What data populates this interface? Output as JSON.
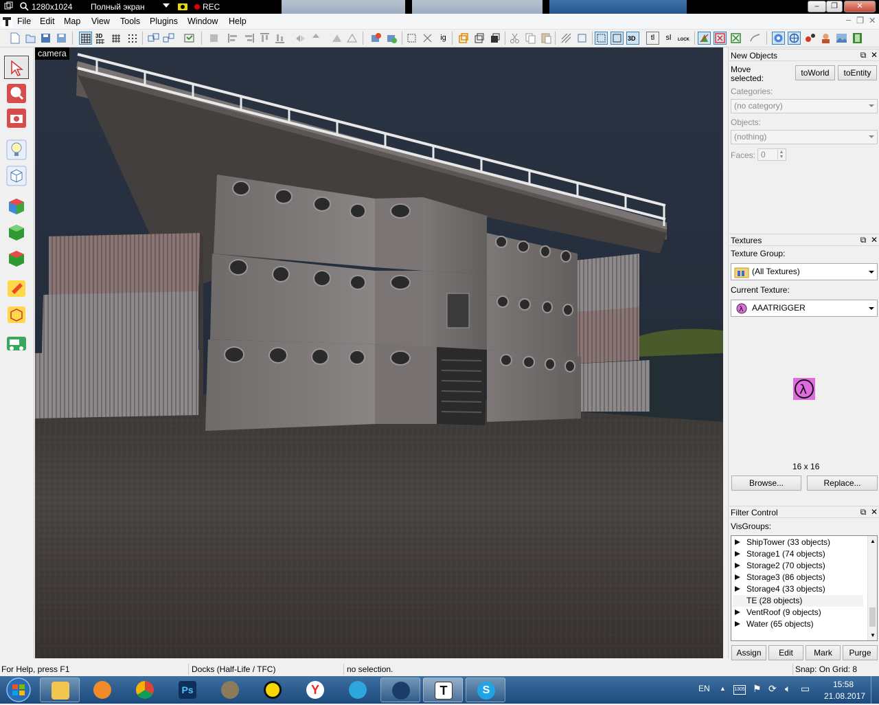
{
  "recorder": {
    "resolution": "1280x1024",
    "mode": "Полный экран",
    "rec_label": "REC"
  },
  "menu": [
    "File",
    "Edit",
    "Map",
    "View",
    "Tools",
    "Plugins",
    "Window",
    "Help"
  ],
  "toolbar": {
    "icons": [
      "new-file-icon",
      "open-file-icon",
      "save-icon",
      "save-as-icon",
      "grid-icon",
      "grid-3d-icon",
      "grid-small-icon",
      "grid-dots-icon",
      "group-icon",
      "ungroup-icon",
      "load-window-state-icon",
      "save-window-state-icon",
      "texture-lock-icon",
      "align-left-icon",
      "align-right-icon",
      "align-top-icon",
      "align-bottom-icon",
      "flip-horizontal-icon",
      "flip-vertical-icon",
      "carve-icon",
      "hollow-icon",
      "run-map-icon",
      "check-problems-icon",
      "transform-icon",
      "cut-icon",
      "copy-icon",
      "paste-icon",
      "toggle-texture-lock-icon",
      "ignore-groups-icon",
      "hide-selected-icon",
      "hide-unselected-icon",
      "show-all-icon",
      "tie-to-entity-icon",
      "move-to-world-icon",
      "lock-icon",
      "entity-report-icon",
      "select-brushes-icon",
      "select-entities-icon",
      "select-all-icon",
      "smoothing-groups-icon",
      "camera-view-icon",
      "camera-3d-icon",
      "color-icon",
      "user-icon",
      "render-view-icon",
      "film-icon"
    ],
    "text_buttons": [
      "ig",
      "tl",
      "sl"
    ]
  },
  "left_tools": [
    "selection-tool-icon",
    "magnify-tool-icon",
    "camera-tool-icon",
    "entity-tool-icon",
    "block-tool-icon",
    "texture-application-icon",
    "apply-current-texture-icon",
    "decal-tool-icon",
    "clipping-tool-icon",
    "vertex-manipulation-icon",
    "path-tool-icon"
  ],
  "viewport": {
    "label": "camera"
  },
  "new_objects": {
    "title": "New Objects",
    "move_selected_label_line1": "Move",
    "move_selected_label_line2": "selected:",
    "to_world": "toWorld",
    "to_entity": "toEntity",
    "categories_label": "Categories:",
    "categories_value": "(no category)",
    "objects_label": "Objects:",
    "objects_value": "(nothing)",
    "faces_label": "Faces:",
    "faces_value": "0"
  },
  "textures": {
    "title": "Textures",
    "group_label": "Texture Group:",
    "group_value": "(All Textures)",
    "current_label": "Current Texture:",
    "current_value": "AAATRIGGER",
    "size": "16 x 16",
    "browse": "Browse...",
    "replace": "Replace..."
  },
  "filter": {
    "title": "Filter Control",
    "visgroups_label": "VisGroups:",
    "visgroups": [
      {
        "name": "ShipTower (33 objects)",
        "selected": false
      },
      {
        "name": "Storage1 (74 objects)",
        "selected": false
      },
      {
        "name": "Storage2 (70 objects)",
        "selected": false
      },
      {
        "name": "Storage3 (86 objects)",
        "selected": false
      },
      {
        "name": "Storage4 (33 objects)",
        "selected": false
      },
      {
        "name": "TE (28 objects)",
        "selected": true
      },
      {
        "name": "VentRoof (9 objects)",
        "selected": false
      },
      {
        "name": "Water (65 objects)",
        "selected": false
      }
    ],
    "assign": "Assign",
    "edit": "Edit",
    "mark": "Mark",
    "purge": "Purge"
  },
  "status": {
    "help": "For Help, press F1",
    "map": "Docks (Half-Life / TFC)",
    "selection": "no selection.",
    "snap": "Snap: On Grid: 8"
  },
  "taskbar": {
    "apps": [
      "file-explorer-icon",
      "media-player-icon",
      "chrome-icon",
      "photoshop-icon",
      "gimp-icon",
      "bandicam-icon",
      "yandex-icon",
      "telegram-icon",
      "steam-icon",
      "hammer-editor-icon",
      "skype-icon"
    ],
    "language": "EN",
    "time": "15:58",
    "date": "21.08.2017"
  },
  "colors": {
    "accent": "#3c7fb1",
    "rec_red": "#e00000",
    "texture_magenta": "#e06ae0"
  }
}
